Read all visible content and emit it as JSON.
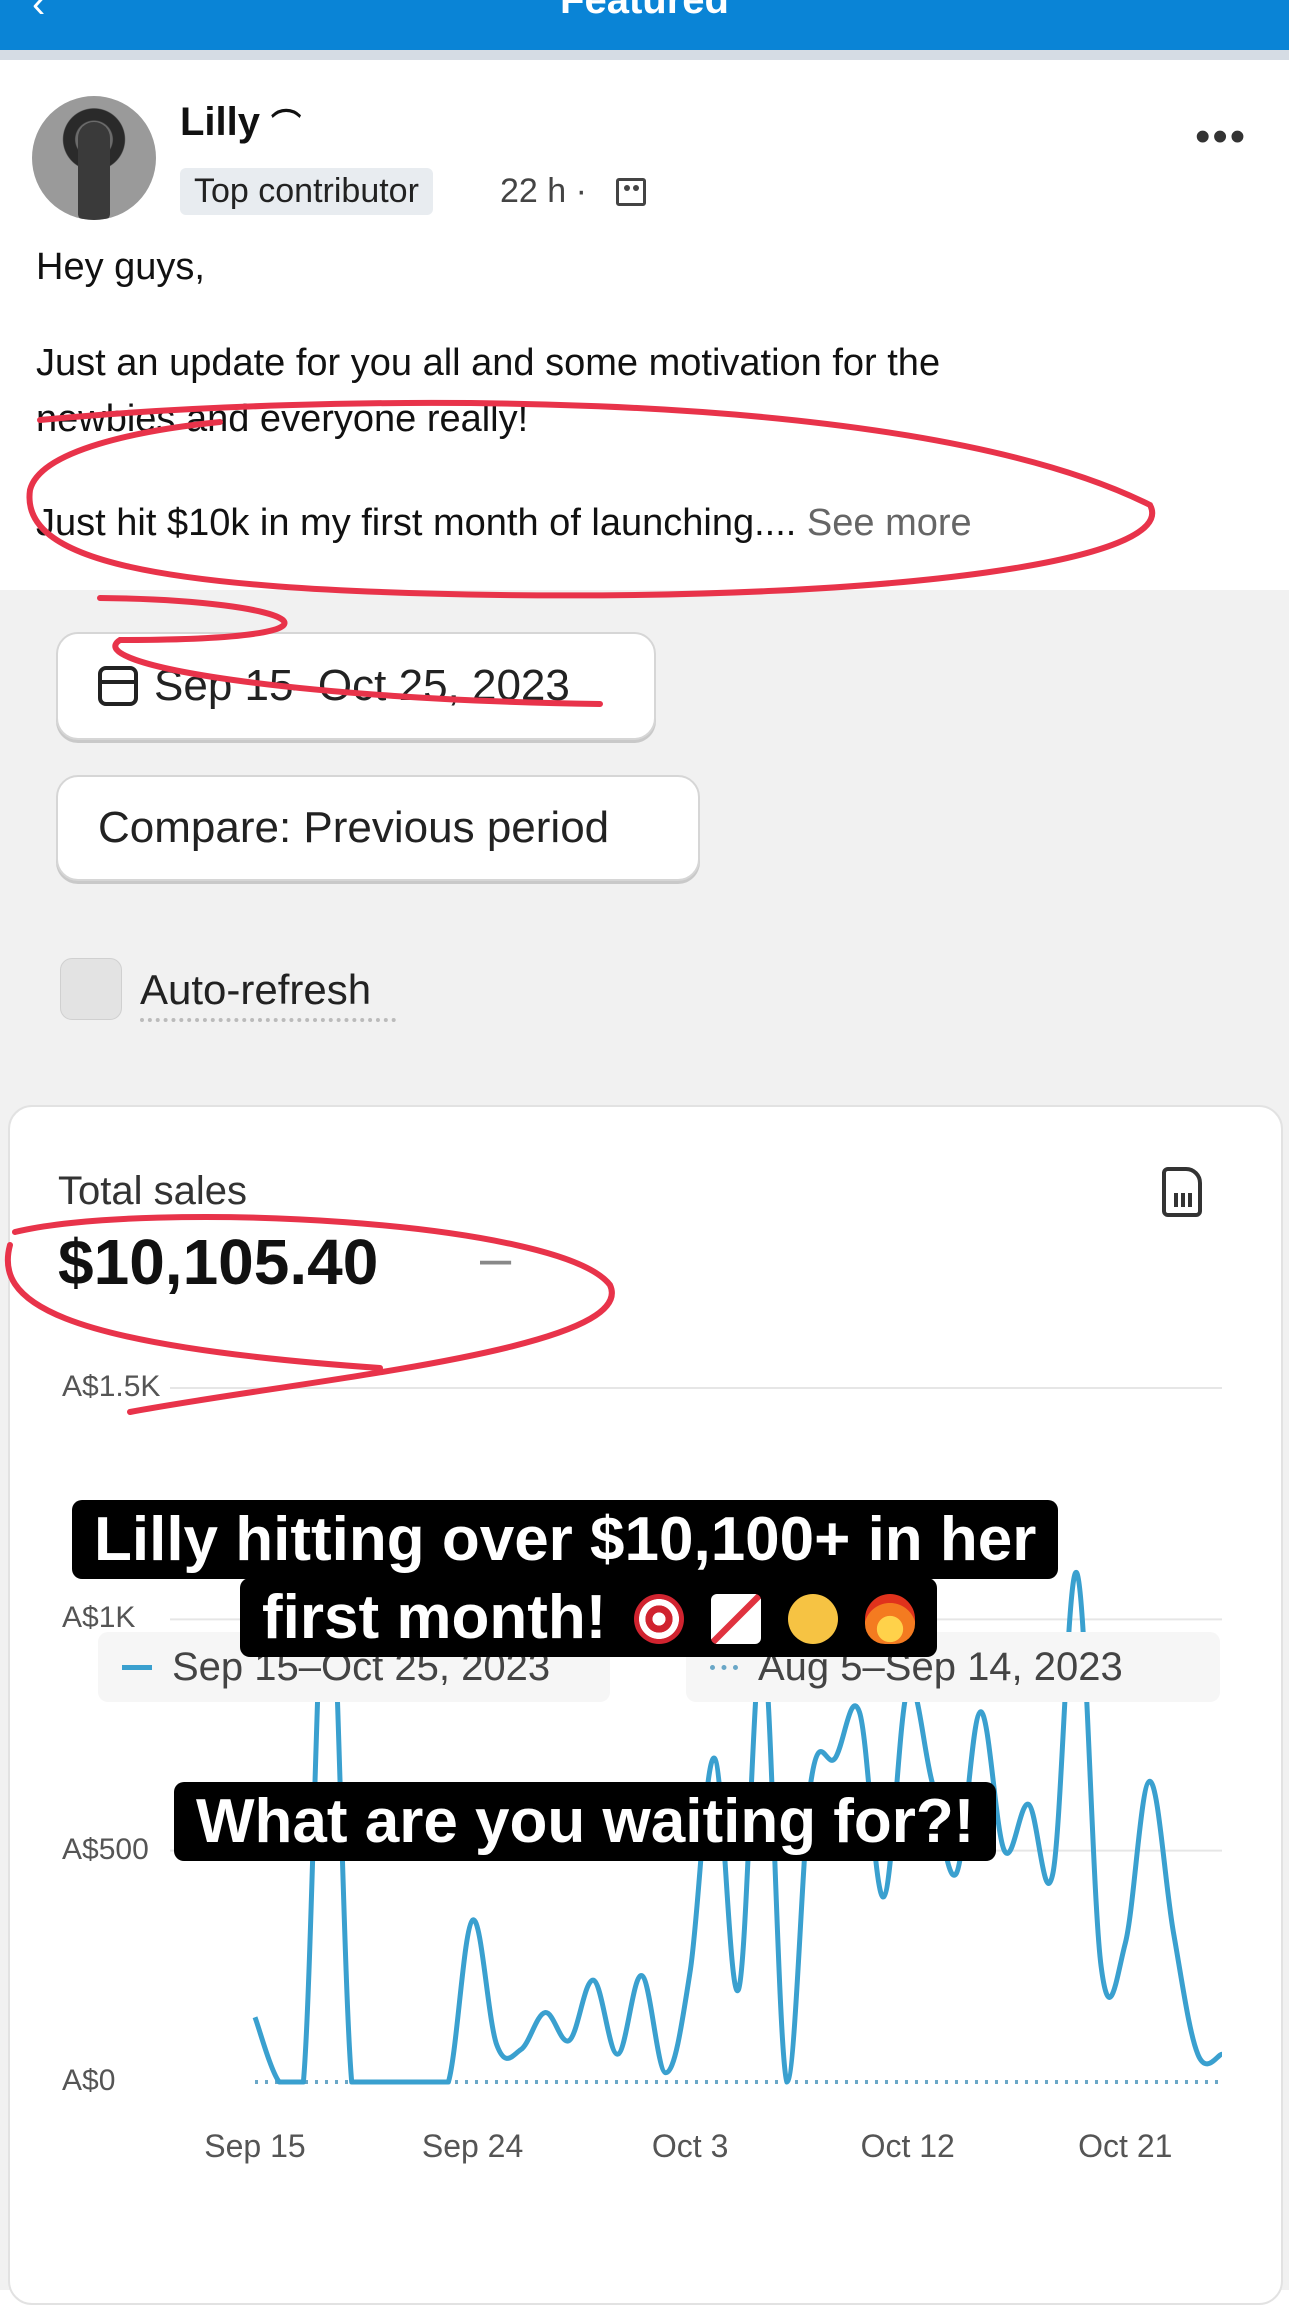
{
  "app": {
    "header_title": "Featured",
    "back_glyph": "‹"
  },
  "post": {
    "author": "Lilly",
    "author_suffix": "⌒",
    "badge": "Top contributor",
    "meta": "22 h ·",
    "more_glyph": "•••",
    "greeting": "Hey guys,",
    "line1": "Just an update for you all and some motivation for the",
    "line2": "newbies and everyone really!",
    "line3": "Just hit $10k in my first month of launching....",
    "see_more": "See more"
  },
  "dashboard": {
    "date_range": "Sep 15–Oct 25, 2023",
    "compare": "Compare: Previous period",
    "auto_refresh": "Auto-refresh",
    "metric_title": "Total sales",
    "metric_value": "$10,105.40",
    "metric_change": "–",
    "legend_current": "Sep 15–Oct 25, 2023",
    "legend_previous": "Aug 5–Sep 14, 2023"
  },
  "overlay": {
    "caption_line1": "Lilly hitting over $10,100+ in her",
    "caption_line2": "first month!",
    "caption_emojis": [
      "target-emoji",
      "chart-increasing-emoji",
      "ok-hand-emoji",
      "fire-emoji"
    ],
    "caption_question": "What are you waiting for?!"
  },
  "chart_data": {
    "type": "line",
    "title": "Total sales",
    "y_ticks": [
      "A$0",
      "A$500",
      "A$1K",
      "A$1.5K"
    ],
    "x_ticks": [
      "Sep 15",
      "Sep 24",
      "Oct 3",
      "Oct 12",
      "Oct 21"
    ],
    "ylim": [
      0,
      1500
    ],
    "series": [
      {
        "name": "Sep 15–Oct 25, 2023",
        "color": "#3aa0cf",
        "x": [
          "Sep 15",
          "Sep 16",
          "Sep 17",
          "Sep 18",
          "Sep 19",
          "Sep 20",
          "Sep 21",
          "Sep 22",
          "Sep 23",
          "Sep 24",
          "Sep 25",
          "Sep 26",
          "Sep 27",
          "Sep 28",
          "Sep 29",
          "Sep 30",
          "Oct 1",
          "Oct 2",
          "Oct 3",
          "Oct 4",
          "Oct 5",
          "Oct 6",
          "Oct 7",
          "Oct 8",
          "Oct 9",
          "Oct 10",
          "Oct 11",
          "Oct 12",
          "Oct 13",
          "Oct 14",
          "Oct 15",
          "Oct 16",
          "Oct 17",
          "Oct 18",
          "Oct 19",
          "Oct 20",
          "Oct 21",
          "Oct 22",
          "Oct 23",
          "Oct 24",
          "Oct 25"
        ],
        "values": [
          140,
          0,
          0,
          1200,
          0,
          0,
          0,
          0,
          0,
          350,
          80,
          70,
          150,
          90,
          220,
          60,
          230,
          20,
          240,
          700,
          200,
          950,
          0,
          650,
          700,
          800,
          400,
          850,
          650,
          450,
          800,
          500,
          600,
          450,
          1100,
          250,
          300,
          650,
          320,
          60,
          60
        ]
      },
      {
        "name": "Aug 5–Sep 14, 2023",
        "color": "#6aa7c7",
        "values": [
          0,
          0,
          0,
          0,
          0,
          0,
          0,
          0,
          0,
          0,
          0,
          0,
          0,
          0,
          0,
          0,
          0,
          0,
          0,
          0,
          0,
          0,
          0,
          0,
          0,
          0,
          0,
          0,
          0,
          0,
          0,
          0,
          0,
          0,
          0,
          0,
          0,
          0,
          0,
          0,
          0
        ]
      }
    ]
  },
  "colors": {
    "header": "#0a84d6",
    "annotation": "#e8334a",
    "line": "#3aa0cf"
  }
}
